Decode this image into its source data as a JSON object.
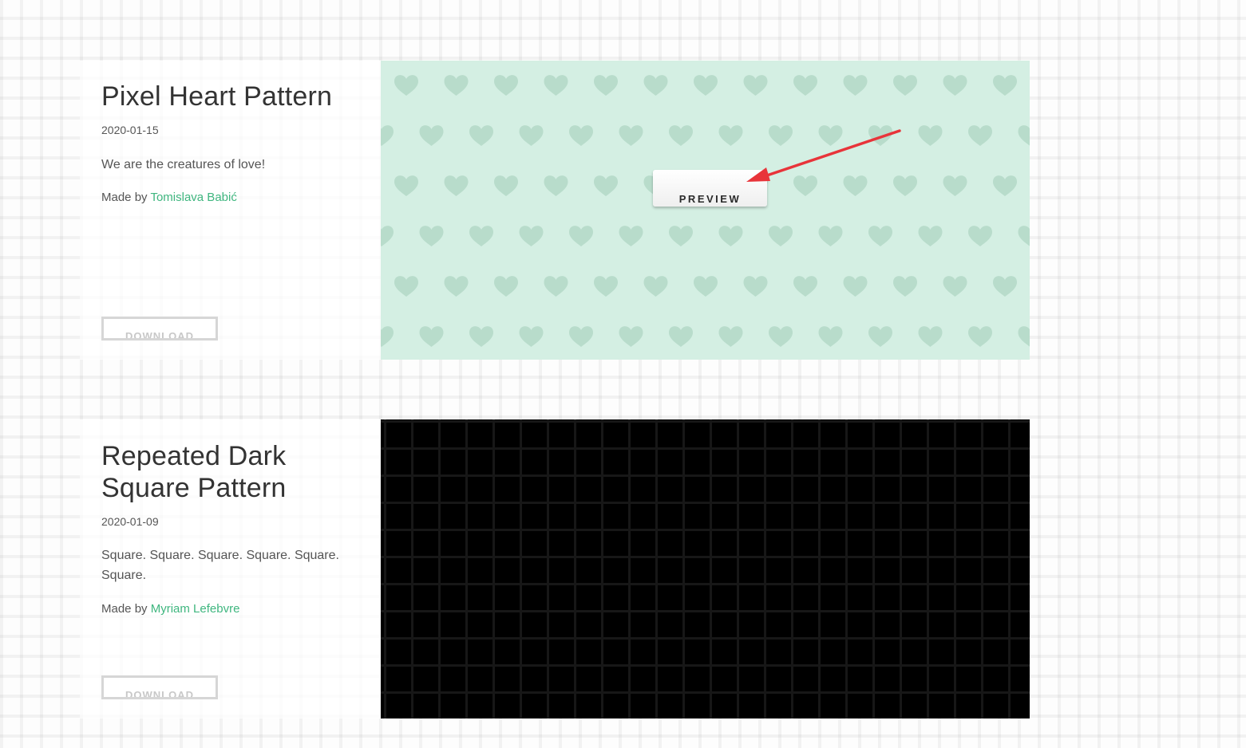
{
  "patterns": [
    {
      "title": "Pixel Heart Pattern",
      "date": "2020-01-15",
      "description": "We are the creatures of love!",
      "made_by_prefix": "Made by",
      "author": "Tomislava Babić",
      "download_label": "DOWNLOAD",
      "preview_label": "PREVIEW",
      "preview_color": "#d4efe3",
      "heart_color": "#b8dccb"
    },
    {
      "title": "Repeated Dark Square Pattern",
      "date": "2020-01-09",
      "description": "Square. Square. Square. Square. Square. Square.",
      "made_by_prefix": "Made by",
      "author": "Myriam Lefebvre",
      "download_label": "DOWNLOAD",
      "preview_color": "#000000"
    }
  ],
  "annotation": {
    "arrow_color": "#e8343a",
    "arrow_target": "preview-button"
  },
  "colors": {
    "accent_link": "#3fb67f",
    "text": "#555555",
    "title": "#333333"
  }
}
